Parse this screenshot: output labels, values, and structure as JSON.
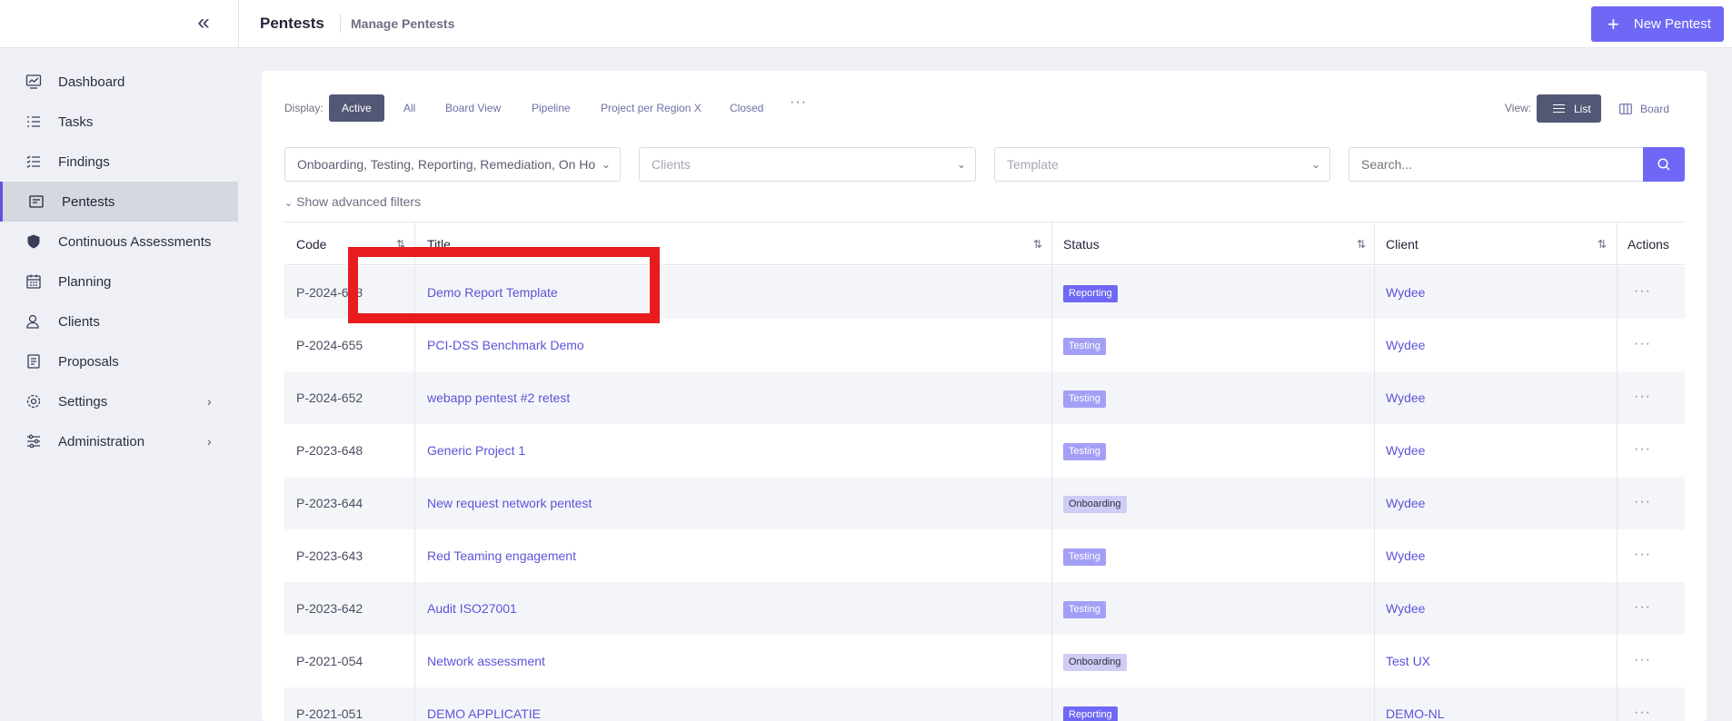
{
  "topbar": {
    "collapse_icon": "double-chevron-left",
    "title": "Pentests",
    "subtitle": "Manage Pentests",
    "new_button": "New Pentest"
  },
  "sidebar": {
    "items": [
      {
        "label": "Dashboard",
        "icon": "dashboard-icon"
      },
      {
        "label": "Tasks",
        "icon": "tasks-icon"
      },
      {
        "label": "Findings",
        "icon": "findings-icon"
      },
      {
        "label": "Pentests",
        "icon": "pentests-icon",
        "active": true
      },
      {
        "label": "Continuous Assessments",
        "icon": "shield-icon"
      },
      {
        "label": "Planning",
        "icon": "calendar-icon"
      },
      {
        "label": "Clients",
        "icon": "clients-icon"
      },
      {
        "label": "Proposals",
        "icon": "proposals-icon"
      },
      {
        "label": "Settings",
        "icon": "gear-icon",
        "has_submenu": true
      },
      {
        "label": "Administration",
        "icon": "sliders-icon",
        "has_submenu": true
      }
    ]
  },
  "display": {
    "label": "Display:",
    "tabs": [
      "Active",
      "All",
      "Board View",
      "Pipeline",
      "Project per Region X",
      "Closed"
    ],
    "active_tab": "Active",
    "more": "···"
  },
  "view": {
    "label": "View:",
    "list": "List",
    "board": "Board",
    "active": "List"
  },
  "filters": {
    "status_value": "Onboarding, Testing, Reporting, Remediation, On Ho",
    "clients_placeholder": "Clients",
    "template_placeholder": "Template",
    "search_placeholder": "Search...",
    "advanced": "Show advanced filters"
  },
  "table": {
    "headers": {
      "code": "Code",
      "title": "Title",
      "status": "Status",
      "client": "Client",
      "actions": "Actions"
    },
    "rows": [
      {
        "code": "P-2024-658",
        "title": "Demo Report Template",
        "status": "Reporting",
        "client": "Wydee"
      },
      {
        "code": "P-2024-655",
        "title": "PCI-DSS Benchmark Demo",
        "status": "Testing",
        "client": "Wydee"
      },
      {
        "code": "P-2024-652",
        "title": "webapp pentest #2 retest",
        "status": "Testing",
        "client": "Wydee"
      },
      {
        "code": "P-2023-648",
        "title": "Generic Project 1",
        "status": "Testing",
        "client": "Wydee"
      },
      {
        "code": "P-2023-644",
        "title": "New request network pentest",
        "status": "Onboarding",
        "client": "Wydee"
      },
      {
        "code": "P-2023-643",
        "title": "Red Teaming engagement",
        "status": "Testing",
        "client": "Wydee"
      },
      {
        "code": "P-2023-642",
        "title": "Audit ISO27001",
        "status": "Testing",
        "client": "Wydee"
      },
      {
        "code": "P-2021-054",
        "title": "Network assessment",
        "status": "Onboarding",
        "client": "Test UX"
      },
      {
        "code": "P-2021-051",
        "title": "DEMO APPLICATIE",
        "status": "Reporting",
        "client": "DEMO-NL"
      }
    ],
    "actions_glyph": "···"
  },
  "colors": {
    "accent": "#6f68f6",
    "highlight": "#e81c1e",
    "segment_active": "#525775"
  }
}
